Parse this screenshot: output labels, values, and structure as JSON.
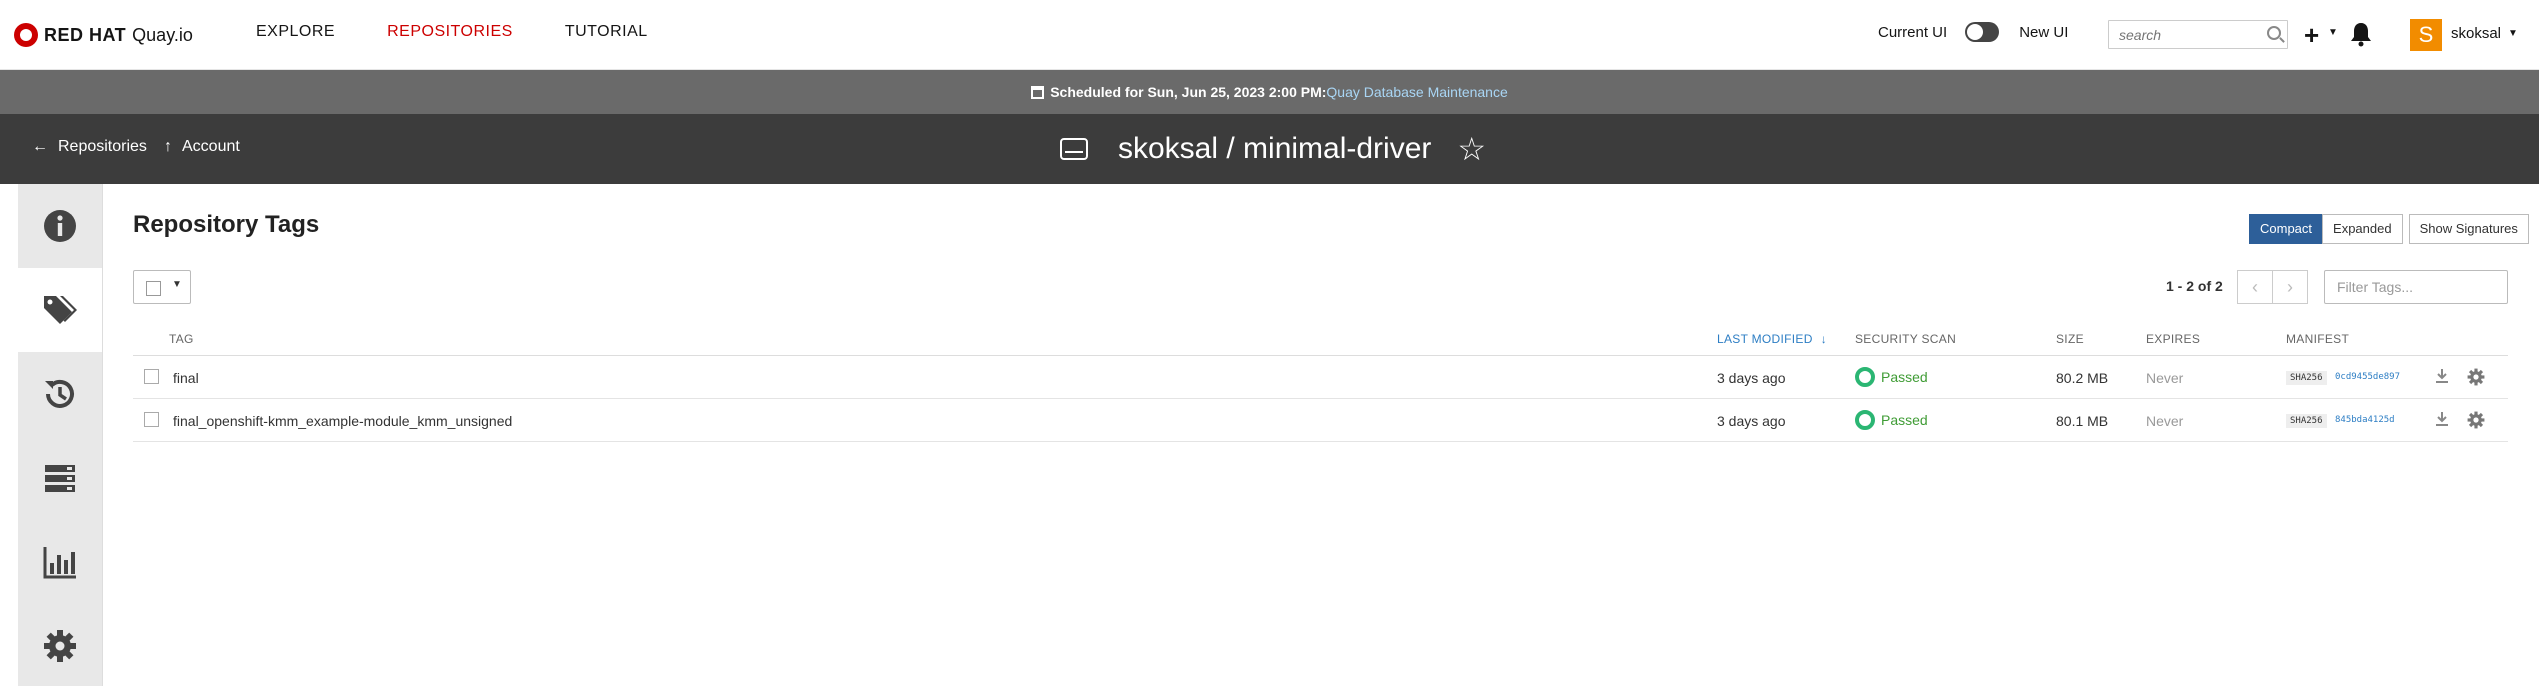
{
  "nav": {
    "brand_redhat": "RED HAT",
    "brand_quay": "Quay.io",
    "links": [
      "EXPLORE",
      "REPOSITORIES",
      "TUTORIAL"
    ],
    "active_link": "REPOSITORIES",
    "current_ui_label": "Current UI",
    "new_ui_label": "New UI",
    "search_placeholder": "search",
    "avatar_letter": "S",
    "username": "skoksal",
    "accent_color": "#cc0000",
    "avatar_color": "#f28c00"
  },
  "banner": {
    "text": "Scheduled for Sun, Jun 25, 2023 2:00 PM:",
    "link": "Quay Database Maintenance"
  },
  "repo_header": {
    "back_label": "Repositories",
    "account_label": "Account",
    "title": "skoksal / minimal-driver"
  },
  "sidebar": {
    "items": [
      {
        "icon": "info-icon",
        "active": false
      },
      {
        "icon": "tags-icon",
        "active": true
      },
      {
        "icon": "history-icon",
        "active": false
      },
      {
        "icon": "builds-icon",
        "active": false
      },
      {
        "icon": "usage-chart-icon",
        "active": false
      },
      {
        "icon": "settings-gear-icon",
        "active": false
      }
    ]
  },
  "main": {
    "title": "Repository Tags",
    "view_buttons": {
      "compact": "Compact",
      "expanded": "Expanded",
      "signatures": "Show Signatures"
    },
    "pager_text": "1 - 2 of 2",
    "filter_placeholder": "Filter Tags...",
    "table": {
      "headers": {
        "tag": "TAG",
        "last_modified": "LAST MODIFIED",
        "security_scan": "SECURITY SCAN",
        "size": "SIZE",
        "expires": "EXPIRES",
        "manifest": "MANIFEST"
      },
      "rows": [
        {
          "tag": "final",
          "last_modified": "3 days ago",
          "security_scan": "Passed",
          "size": "80.2 MB",
          "expires": "Never",
          "sha_label": "SHA256",
          "sha_value": "0cd9455de897"
        },
        {
          "tag": "final_openshift-kmm_example-module_kmm_unsigned",
          "last_modified": "3 days ago",
          "security_scan": "Passed",
          "size": "80.1 MB",
          "expires": "Never",
          "sha_label": "SHA256",
          "sha_value": "845bda4125d"
        }
      ]
    }
  }
}
